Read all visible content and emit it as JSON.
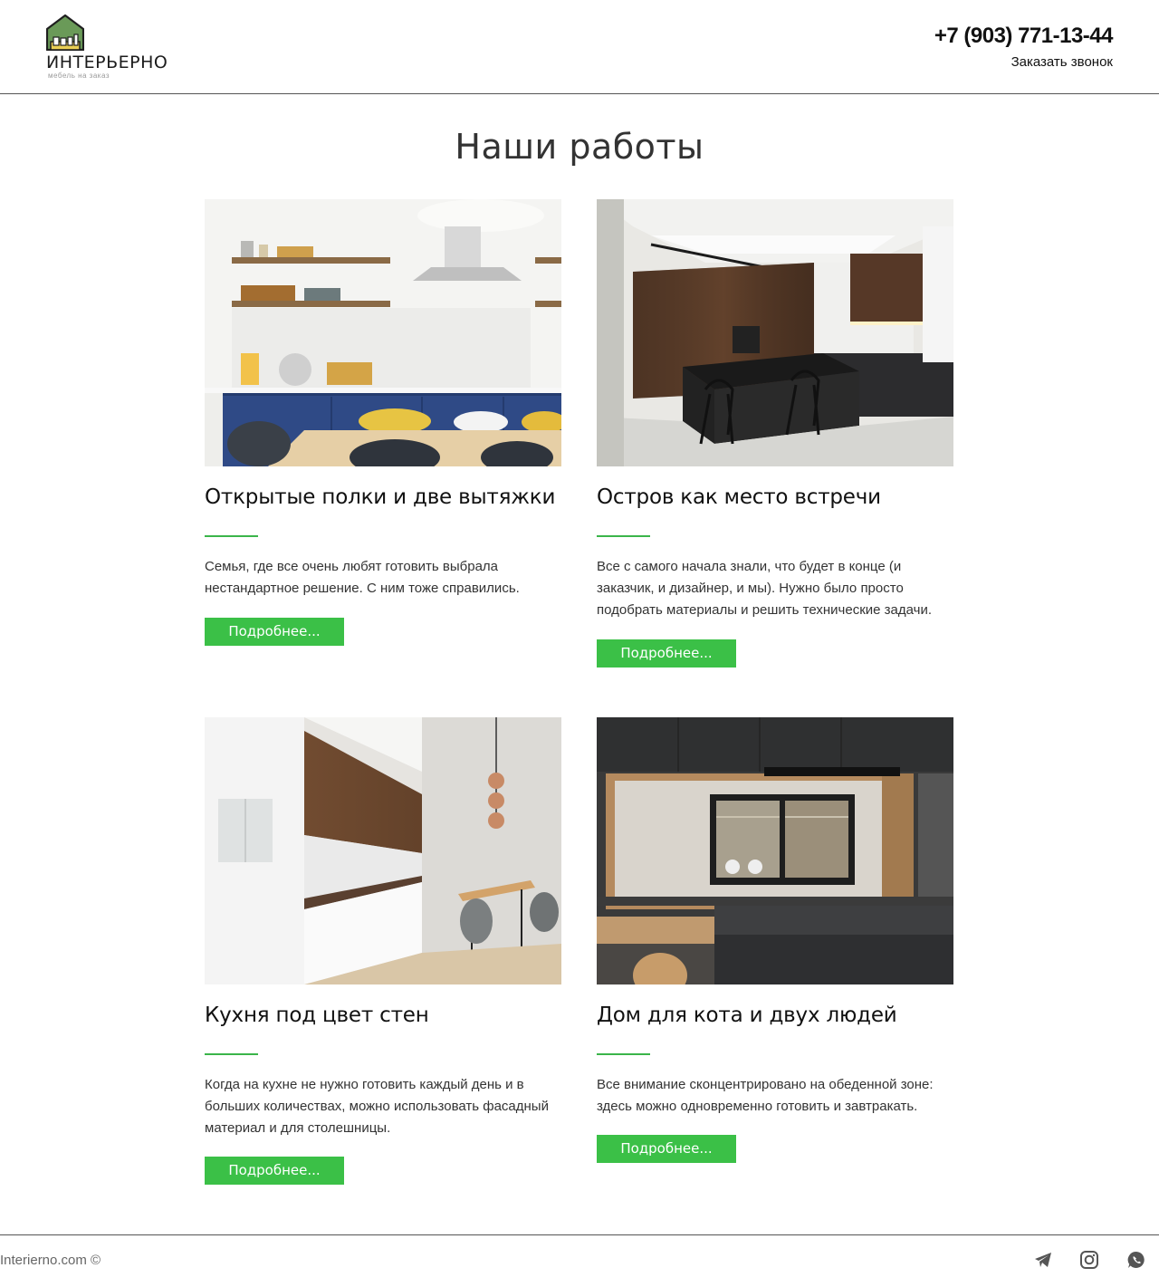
{
  "brand": {
    "name": "ИНТЕРЬЕРНО",
    "tagline": "мебель на заказ"
  },
  "contact": {
    "phone": "+7 (903) 771-13-44",
    "callback": "Заказать звонок"
  },
  "page": {
    "title": "Наши работы"
  },
  "projects": [
    {
      "title": "Открытые полки и две вытяжки",
      "description": "Семья, где все очень любят готовить выбрала нестандартное решение. С ним тоже справились.",
      "button": "Подробнее..."
    },
    {
      "title": "Остров как место встречи",
      "description": "Все с самого начала знали, что будет в конце (и заказчик, и дизайнер, и мы). Нужно было просто подобрать материалы и решить технические задачи.",
      "button": "Подробнее..."
    },
    {
      "title": "Кухня под цвет стен",
      "description": "Когда на кухне не нужно готовить каждый день и в больших количествах, можно использовать фасадный материал и для столешницы.",
      "button": "Подробнее..."
    },
    {
      "title": "Дом для кота и двух людей",
      "description": "Все внимание сконцентрировано на обеденной зоне: здесь можно одновременно готовить и завтракать.",
      "button": "Подробнее..."
    }
  ],
  "footer": {
    "copyright": "Interierno.com ©",
    "social": [
      "telegram-icon",
      "instagram-icon",
      "whatsapp-icon"
    ]
  },
  "colors": {
    "accent": "#3bc047",
    "logo_green": "#6a9a58"
  }
}
